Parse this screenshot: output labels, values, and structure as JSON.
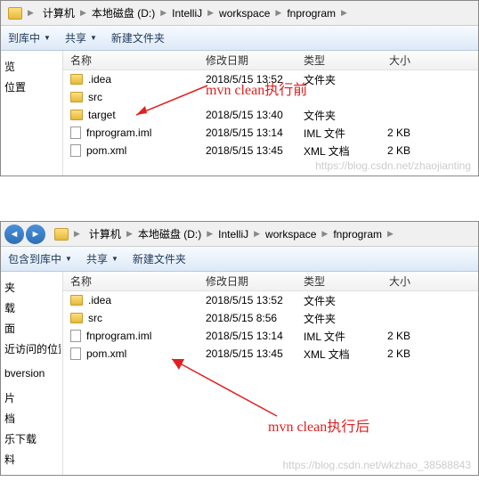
{
  "top_window": {
    "breadcrumb": [
      "计算机",
      "本地磁盘 (D:)",
      "IntelliJ",
      "workspace",
      "fnprogram"
    ],
    "toolbar": {
      "include": "到库中",
      "share": "共享",
      "new_folder": "新建文件夹"
    },
    "columns": {
      "name": "名称",
      "date": "修改日期",
      "type": "类型",
      "size": "大小"
    },
    "sidebar_items": [
      "览",
      "位置"
    ],
    "files": [
      {
        "name": ".idea",
        "date": "2018/5/15 13:52",
        "type": "文件夹",
        "size": "",
        "is_folder": true
      },
      {
        "name": "src",
        "date": "",
        "type": "",
        "size": "",
        "is_folder": true
      },
      {
        "name": "target",
        "date": "2018/5/15 13:40",
        "type": "文件夹",
        "size": "",
        "is_folder": true
      },
      {
        "name": "fnprogram.iml",
        "date": "2018/5/15 13:14",
        "type": "IML 文件",
        "size": "2 KB",
        "is_folder": false
      },
      {
        "name": "pom.xml",
        "date": "2018/5/15 13:45",
        "type": "XML 文档",
        "size": "2 KB",
        "is_folder": false
      }
    ],
    "annotation": "mvn clean执行前",
    "watermark": "https://blog.csdn.net/zhaojianting"
  },
  "bottom_window": {
    "breadcrumb": [
      "计算机",
      "本地磁盘 (D:)",
      "IntelliJ",
      "workspace",
      "fnprogram"
    ],
    "toolbar": {
      "include": "包含到库中",
      "share": "共享",
      "new_folder": "新建文件夹"
    },
    "columns": {
      "name": "名称",
      "date": "修改日期",
      "type": "类型",
      "size": "大小"
    },
    "sidebar_items": [
      "夹",
      "载",
      "面",
      "近访问的位置",
      "",
      "bversion",
      "",
      "片",
      "档",
      "乐下载",
      "料"
    ],
    "files": [
      {
        "name": ".idea",
        "date": "2018/5/15 13:52",
        "type": "文件夹",
        "size": "",
        "is_folder": true
      },
      {
        "name": "src",
        "date": "2018/5/15 8:56",
        "type": "文件夹",
        "size": "",
        "is_folder": true
      },
      {
        "name": "fnprogram.iml",
        "date": "2018/5/15 13:14",
        "type": "IML 文件",
        "size": "2 KB",
        "is_folder": false
      },
      {
        "name": "pom.xml",
        "date": "2018/5/15 13:45",
        "type": "XML 文档",
        "size": "2 KB",
        "is_folder": false
      }
    ],
    "annotation": "mvn clean执行后",
    "watermark": "https://blog.csdn.net/wkzhao_38588843"
  }
}
